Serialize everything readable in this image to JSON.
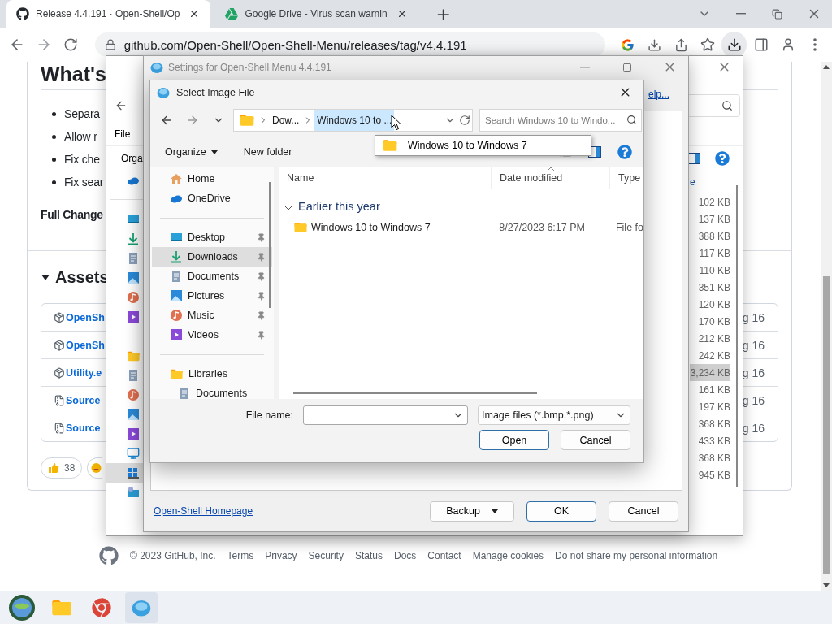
{
  "browser": {
    "tabs": [
      {
        "title": "Release 4.4.191 · Open-Shell/Op",
        "selected": true
      },
      {
        "title": "Google Drive - Virus scan warnin",
        "selected": false
      }
    ],
    "new_tab": "+",
    "address": "github.com/Open-Shell/Open-Shell-Menu/releases/tag/v4.4.191"
  },
  "release": {
    "heading": "What's",
    "bullets": [
      "Separa",
      "Allow r",
      "Fix che",
      "Fix sear"
    ],
    "full_changelog": "Full Change",
    "assets_title": "Assets",
    "assets_expanded": true,
    "assets": [
      {
        "kind": "package",
        "name": "OpenSh",
        "date": "g 16"
      },
      {
        "kind": "package",
        "name": "OpenSh",
        "date": "g 16"
      },
      {
        "kind": "package",
        "name": "Utility.e",
        "date": "g 16"
      },
      {
        "kind": "zip",
        "name": "Source",
        "date": "g 16"
      },
      {
        "kind": "zip",
        "name": "Source",
        "date": "g 16"
      }
    ],
    "reactions": [
      {
        "kind": "thumbs",
        "count": "38"
      },
      {
        "kind": "smile"
      }
    ]
  },
  "footer": {
    "copyright": "© 2023 GitHub, Inc.",
    "links": [
      "Terms",
      "Privacy",
      "Security",
      "Status",
      "Docs",
      "Contact",
      "Manage cookies",
      "Do not share my personal information"
    ]
  },
  "explorer": {
    "menu": "File",
    "toolbar": "Orga",
    "column": "e",
    "sizes": [
      {
        "size": "102 KB",
        "selected": false
      },
      {
        "size": "137 KB",
        "selected": false
      },
      {
        "size": "388 KB",
        "selected": false
      },
      {
        "size": "117 KB",
        "selected": false
      },
      {
        "size": "110 KB",
        "selected": false
      },
      {
        "size": "351 KB",
        "selected": false
      },
      {
        "size": "120 KB",
        "selected": false
      },
      {
        "size": "170 KB",
        "selected": false
      },
      {
        "size": "212 KB",
        "selected": false
      },
      {
        "size": "242 KB",
        "selected": false
      },
      {
        "size": "3,234 KB",
        "selected": true
      },
      {
        "size": "161 KB",
        "selected": false
      },
      {
        "size": "197 KB",
        "selected": false
      },
      {
        "size": "368 KB",
        "selected": false
      },
      {
        "size": "433 KB",
        "selected": false
      },
      {
        "size": "368 KB",
        "selected": false
      },
      {
        "size": "945 KB",
        "selected": false
      }
    ]
  },
  "settings": {
    "title": "Settings for Open-Shell Menu 4.4.191",
    "help_link": "elp...",
    "homepage_link": "Open-Shell Homepage",
    "buttons": [
      {
        "label": "Backup",
        "kind": "split"
      },
      {
        "label": "OK",
        "kind": "default"
      },
      {
        "label": "Cancel",
        "kind": "plain"
      }
    ]
  },
  "dialog": {
    "title": "Select Image File",
    "breadcrumb": [
      {
        "label": "Dow...",
        "selected": false
      },
      {
        "label": "Windows 10 to ...",
        "selected": true
      }
    ],
    "search_placeholder": "Search Windows 10 to Windo...",
    "dropdown": [
      "Windows 10 to Windows 7"
    ],
    "toolbar": {
      "organize": "Organize",
      "new_folder": "New folder"
    },
    "nav": [
      {
        "items": [
          {
            "label": "Home",
            "pinned": false,
            "selected": false
          },
          {
            "label": "OneDrive",
            "pinned": false,
            "selected": false
          }
        ]
      },
      {
        "items": [
          {
            "label": "Desktop",
            "pinned": true,
            "selected": false
          },
          {
            "label": "Downloads",
            "pinned": true,
            "selected": true
          },
          {
            "label": "Documents",
            "pinned": true,
            "selected": false
          },
          {
            "label": "Pictures",
            "pinned": true,
            "selected": false
          },
          {
            "label": "Music",
            "pinned": true,
            "selected": false
          },
          {
            "label": "Videos",
            "pinned": true,
            "selected": false
          }
        ]
      },
      {
        "items": [
          {
            "label": "Libraries",
            "pinned": false,
            "selected": false,
            "children": [
              {
                "label": "Documents",
                "pinned": false,
                "selected": false
              }
            ]
          }
        ]
      }
    ],
    "columns": [
      "Name",
      "Date modified",
      "Type"
    ],
    "group": {
      "label": "Earlier this year",
      "expanded": true
    },
    "files": [
      {
        "name": "Windows 10 to Windows 7",
        "date": "8/27/2023 6:17 PM",
        "type": "File fo"
      }
    ],
    "file_name_label": "File name:",
    "file_type": "Image files (*.bmp,*.png)",
    "buttons": [
      {
        "label": "Open",
        "kind": "default"
      },
      {
        "label": "Cancel",
        "kind": "plain"
      }
    ]
  }
}
